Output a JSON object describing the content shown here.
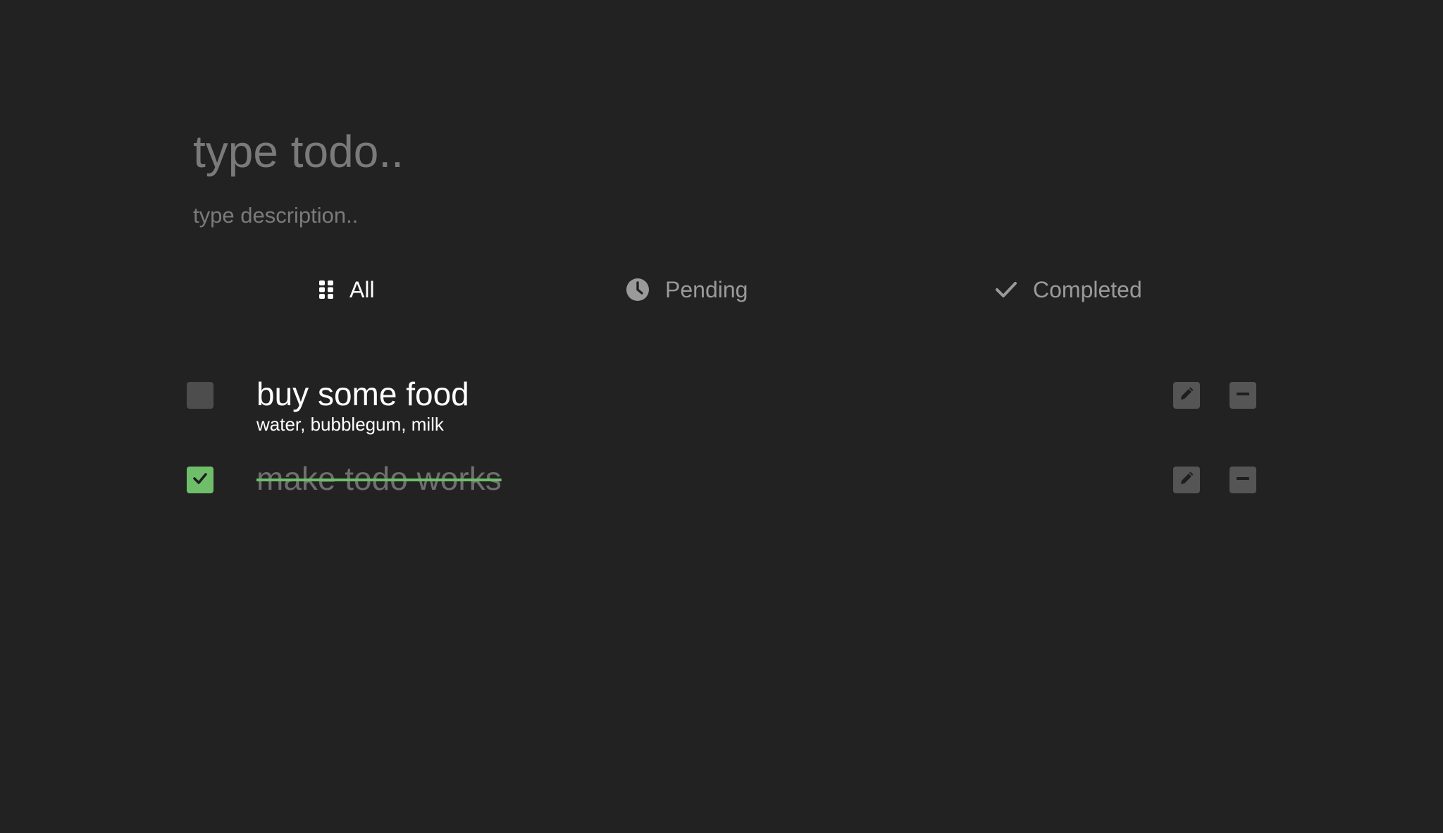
{
  "form": {
    "title_placeholder": "type todo..",
    "description_placeholder": "type description.."
  },
  "filters": [
    {
      "label": "All",
      "icon": "grid-icon",
      "active": true
    },
    {
      "label": "Pending",
      "icon": "clock-icon",
      "active": false
    },
    {
      "label": "Completed",
      "icon": "check-icon",
      "active": false
    }
  ],
  "todos": [
    {
      "title": "buy some food",
      "description": "water, bubblegum, milk",
      "completed": false
    },
    {
      "title": "make todo works",
      "description": "",
      "completed": true
    }
  ],
  "colors": {
    "background": "#222222",
    "accent_green": "#6fbf6a",
    "button_gray": "#555555"
  }
}
